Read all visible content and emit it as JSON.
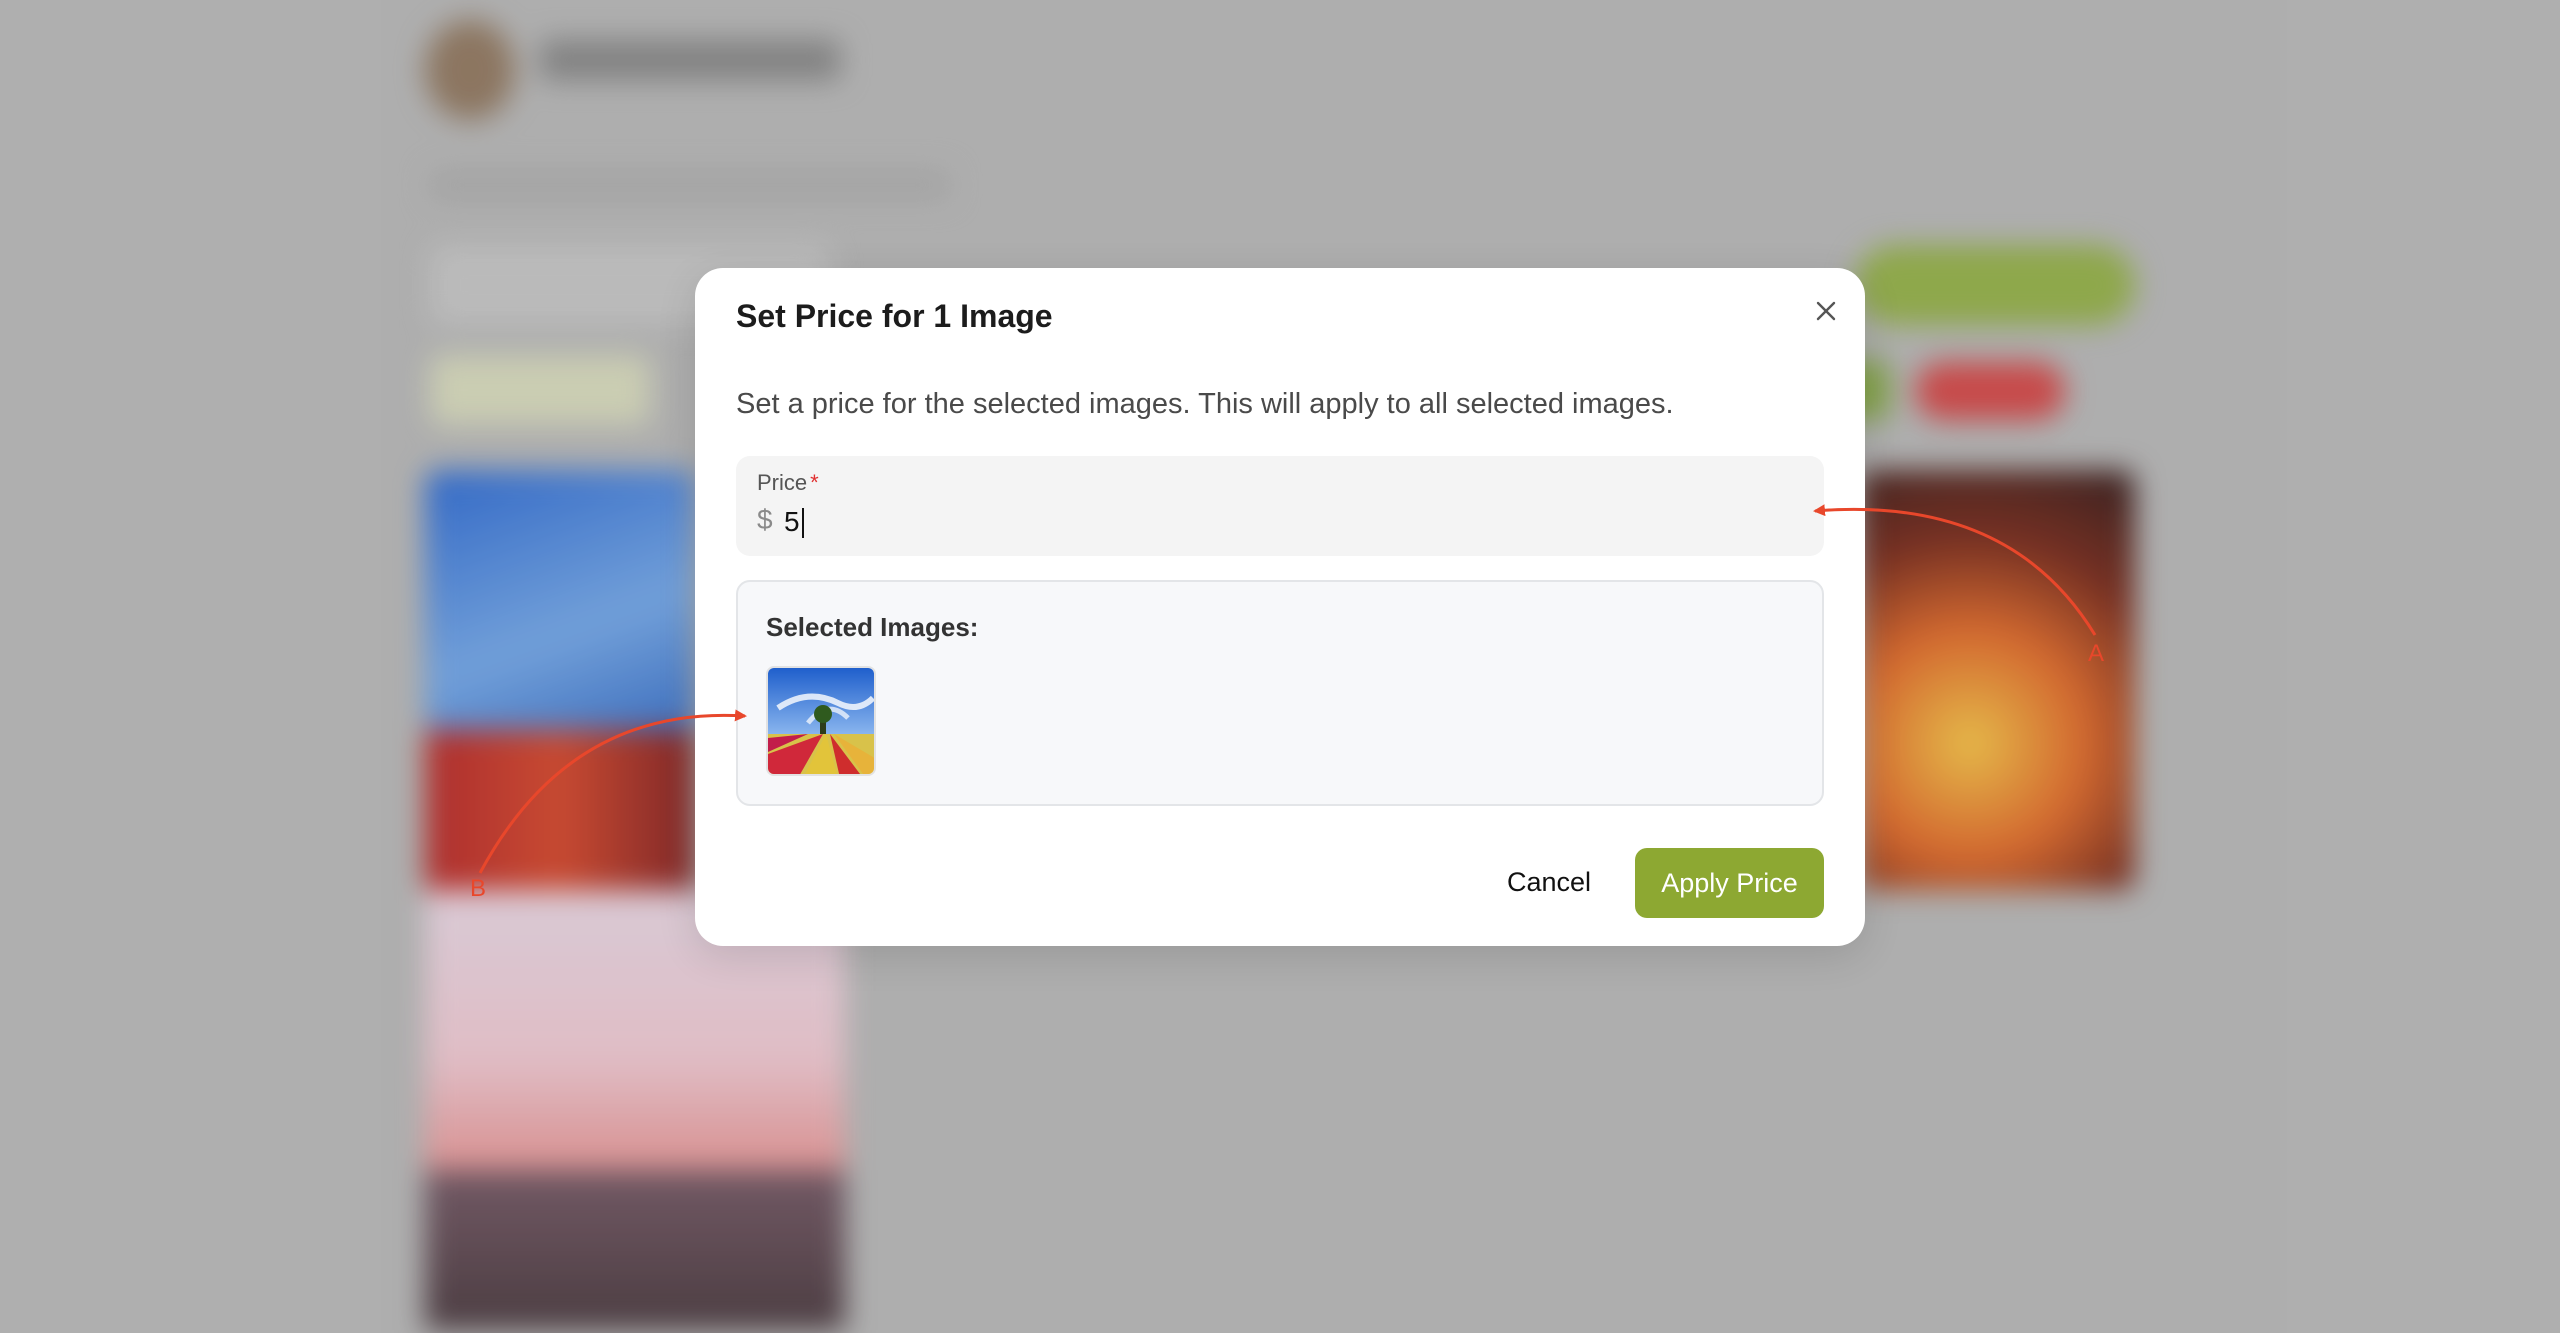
{
  "modal": {
    "title": "Set Price for 1 Image",
    "description": "Set a price for the selected images. This will apply to all selected images.",
    "price_label": "Price",
    "required_marker": "*",
    "currency_symbol": "$",
    "price_value": "5",
    "selected_images_title": "Selected Images:",
    "cancel_label": "Cancel",
    "apply_label": "Apply Price",
    "close_icon": "close-icon"
  },
  "annotations": {
    "arrow_a_label": "A",
    "arrow_b_label": "B"
  },
  "colors": {
    "accent": "#8da832",
    "annotation": "#e8472b",
    "required": "#e03030",
    "overlay": "#b4b4b4"
  }
}
